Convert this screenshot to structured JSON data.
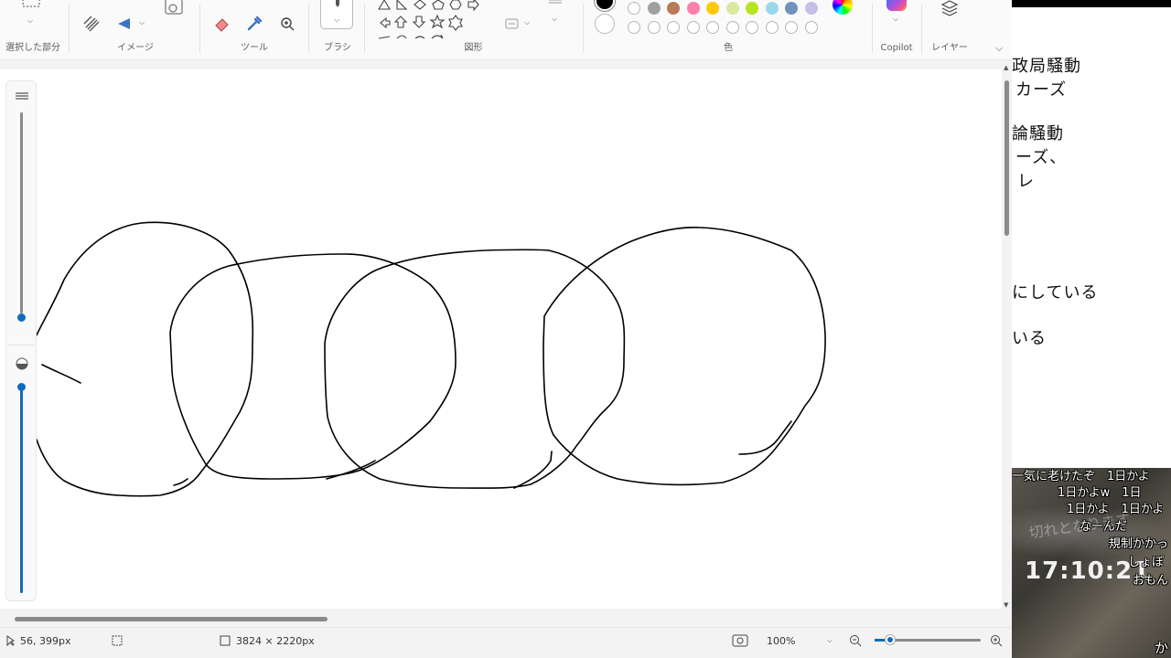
{
  "ribbon": {
    "groups": {
      "selection": "選択した部分",
      "image": "イメージ",
      "tools": "ツール",
      "brushes": "ブラシ",
      "shapes": "図形",
      "colors": "色",
      "copilot": "Copilot",
      "layers": "レイヤー"
    },
    "icons": {
      "selection": "select-rect-icon",
      "image_crop": "crop-icon",
      "image_resize": "resize-icon",
      "image_generate": "image-generate-icon",
      "eraser": "eraser-icon",
      "picker": "color-picker-icon",
      "zoom": "magnifier-icon",
      "brush": "brush-icon",
      "fill": "fill-shape-icon",
      "color_wheel": "color-wheel-icon",
      "copilot": "copilot-icon",
      "layers": "layers-icon",
      "collapse": "chevron-down-icon"
    },
    "palette_row1": [
      "#ffffff",
      "#a0a0a0",
      "#b97a57",
      "#ff7fa8",
      "#ffc90e",
      "#d9e8a0",
      "#b5e61d",
      "#99d9ea",
      "#7092be",
      "#c8bfe7"
    ],
    "palette_row2_count": 10
  },
  "status": {
    "cursor_position": "56, 399px",
    "canvas_size": "3824 × 2220px",
    "zoom": "100%"
  },
  "overlay": {
    "lines": [
      "政局騒動",
      "カーズ",
      "論騒動",
      "ーズ、",
      "レ",
      "にしている",
      "いる"
    ],
    "comments": [
      "一気に老けたぞ　1日かよ",
      "1日かよw　1日",
      "1日かよ　1日かよ",
      "なーんだ",
      "規制かかっ",
      "しょぼ",
      "おもん"
    ],
    "clock": "17:10:21",
    "bg_text": "切れとなります",
    "bottom_text": "か"
  }
}
